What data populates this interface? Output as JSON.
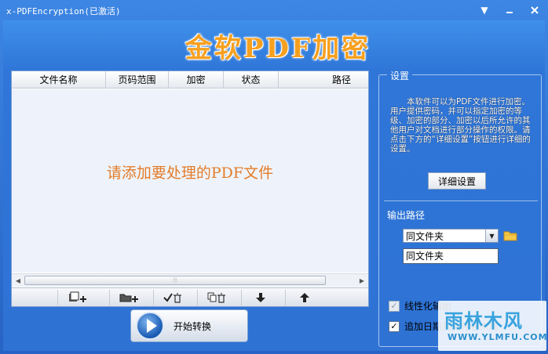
{
  "window": {
    "title": "x-PDFEncryption(已激活)",
    "controls": [
      "help-icon",
      "minimize-icon",
      "close-icon"
    ]
  },
  "banner": {
    "text": "金软PDF加密"
  },
  "file_list": {
    "columns": [
      "文件名称",
      "页码范围",
      "加密",
      "状态",
      "路径"
    ],
    "rows": [],
    "empty_hint": "请添加要处理的PDF文件"
  },
  "toolbar": {
    "buttons": [
      "add-file-icon",
      "add-folder-icon",
      "remove-checked-icon",
      "remove-all-icon",
      "move-down-icon",
      "move-up-icon"
    ]
  },
  "start_button": {
    "label": "开始转换"
  },
  "settings": {
    "legend": "设置",
    "description": "本软件可以为PDF文件进行加密。用户提供密码，并可以指定加密的等级、加密的部分、加密以后所允许的其他用户对文档进行部分操作的权限。请点击下方的“详细设置”按钮进行详细的设置。",
    "detail_button": "详细设置",
    "output_path_label": "输出路径",
    "output_select_value": "同文件夹",
    "output_path_value": "同文件夹",
    "linearize": {
      "label": "线性化输出",
      "checked": true,
      "enabled": false
    },
    "append_date": {
      "label": "追加日期到文件名末尾",
      "checked": true,
      "enabled": true
    }
  },
  "watermark": {
    "main": "雨林木风",
    "sub": "WWW.YLMFU.COM"
  },
  "colors": {
    "accent_orange": "#f6a020",
    "window_blue": "#2f76d8",
    "hint_orange": "#e37c2a"
  }
}
